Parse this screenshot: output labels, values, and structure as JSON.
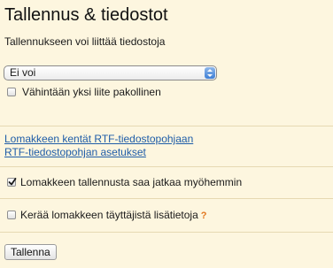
{
  "header": {
    "title": "Tallennus & tiedostot"
  },
  "attachments": {
    "label": "Tallennukseen voi liittää tiedostoja",
    "select_value": "Ei voi",
    "required_label": "Vähintään yksi liite pakollinen",
    "required_checked": false
  },
  "links": {
    "fields_template": "Lomakkeen kentät RTF-tiedostopohjaan",
    "template_settings": "RTF-tiedostopohjan asetukset"
  },
  "options": {
    "continue_later_label": "Lomakkeen tallennusta saa jatkaa myöhemmin",
    "continue_later_checked": true,
    "collect_info_label": "Kerää lomakkeen täyttäjistä lisätietoja",
    "collect_info_checked": false,
    "help_icon": "question-mark-icon"
  },
  "footer": {
    "save_label": "Tallenna"
  }
}
